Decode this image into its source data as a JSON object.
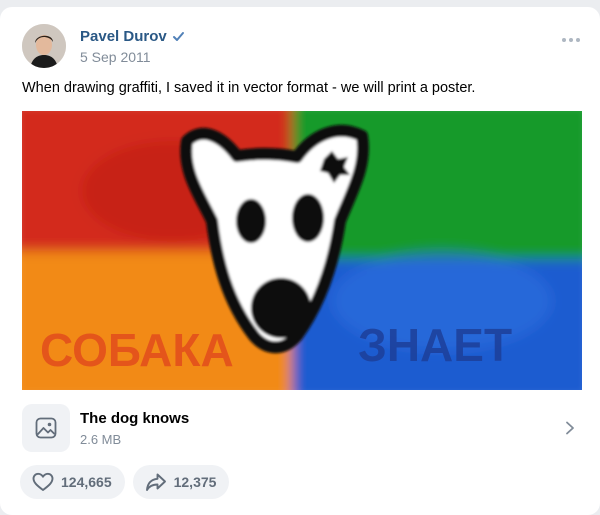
{
  "post": {
    "author": "Pavel Durov",
    "verified": true,
    "date": "5 Sep 2011",
    "text": "When drawing graffiti, I saved it in vector format - we will print a poster.",
    "photo": {
      "quadrant_colors": [
        "#d9271e",
        "#159a2a",
        "#f08a18",
        "#1f5fd1"
      ],
      "words": [
        "СОБАКА",
        "ЗНАЕТ"
      ]
    },
    "attachment": {
      "title": "The dog knows",
      "size": "2.6 MB"
    },
    "actions": {
      "likes": "124,665",
      "shares": "12,375"
    }
  },
  "icons": [
    "verified-check-icon",
    "more-dots-icon",
    "image-doc-icon",
    "chevron-right-icon",
    "heart-icon",
    "share-arrow-icon"
  ]
}
